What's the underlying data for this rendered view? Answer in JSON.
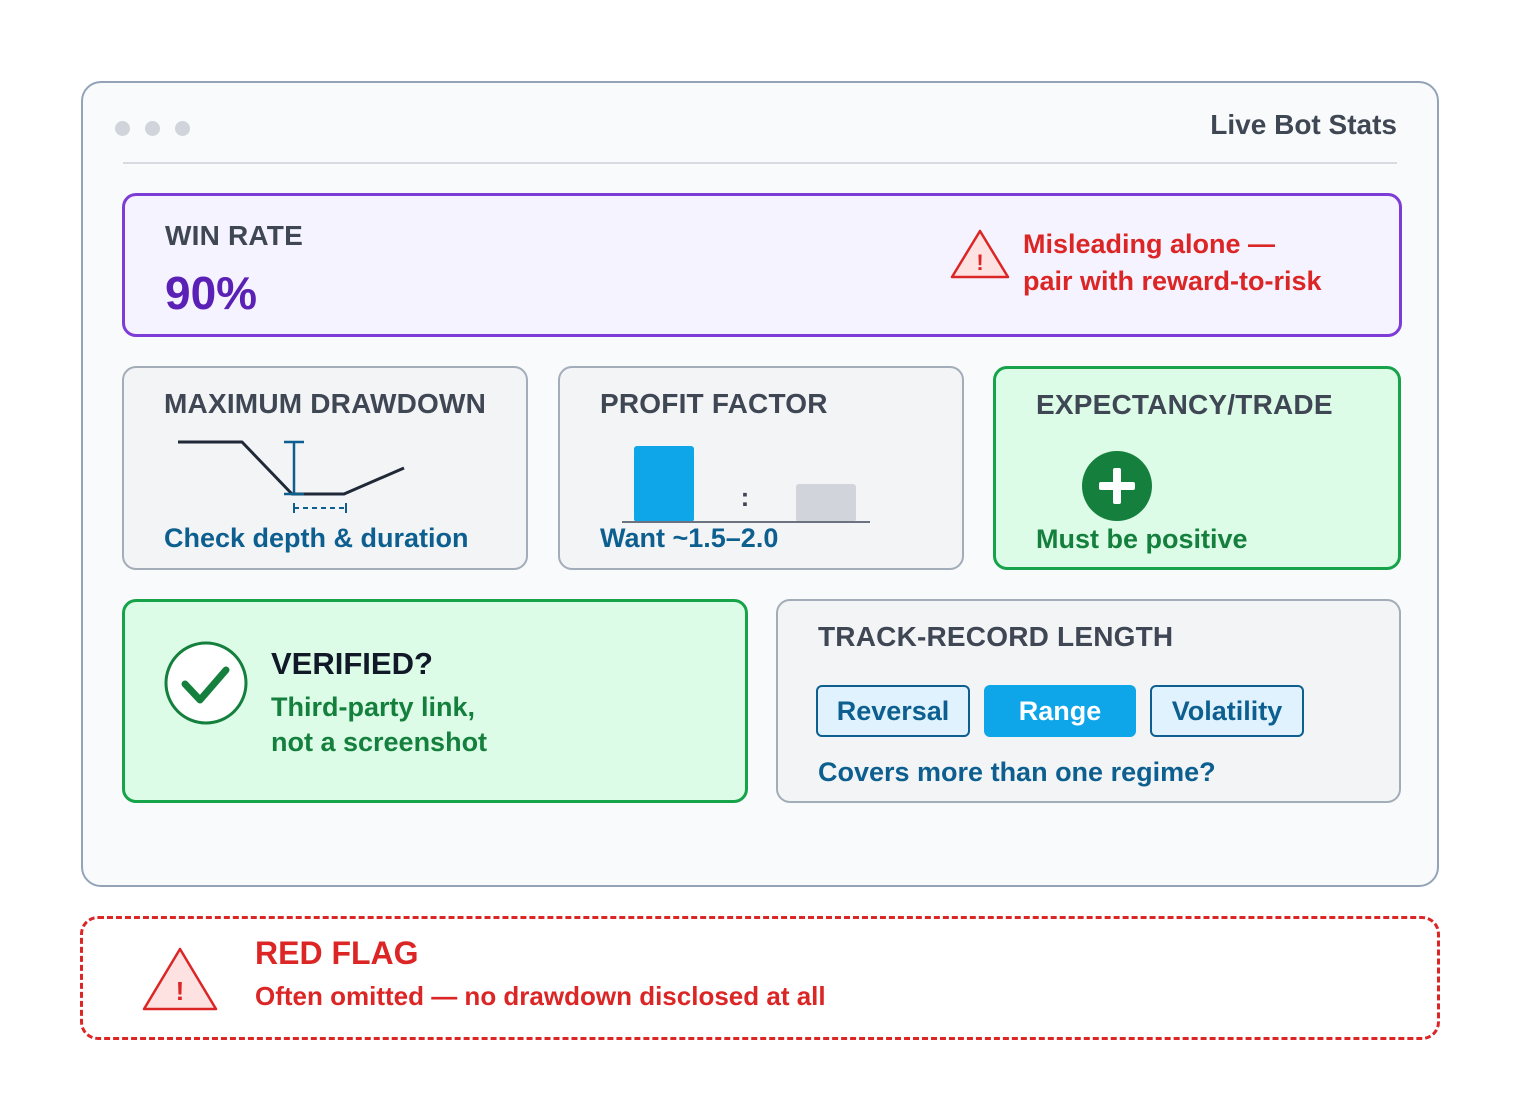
{
  "window": {
    "title": "Live Bot Stats"
  },
  "win_rate": {
    "label": "WIN RATE",
    "value": "90%",
    "warning_line1": "Misleading alone —",
    "warning_line2": "pair with reward-to-risk",
    "warning_icon": "warning-triangle-icon"
  },
  "max_drawdown": {
    "label": "MAXIMUM DRAWDOWN",
    "note": "Check depth & duration",
    "icon": "drawdown-curve-icon"
  },
  "profit_factor": {
    "label": "PROFIT FACTOR",
    "separator": ":",
    "note": "Want ~1.5–2.0",
    "icon": "ratio-bars-icon"
  },
  "expectancy": {
    "label": "EXPECTANCY/TRADE",
    "note": "Must be positive",
    "icon": "plus-circle-icon"
  },
  "verified": {
    "title": "VERIFIED?",
    "line1": "Third-party link,",
    "line2": "not a screenshot",
    "icon": "checkmark-circle-icon"
  },
  "track_record": {
    "label": "TRACK-RECORD LENGTH",
    "chips": [
      {
        "label": "Reversal",
        "active": false
      },
      {
        "label": "Range",
        "active": true
      },
      {
        "label": "Volatility",
        "active": false
      }
    ],
    "question": "Covers more than one regime?"
  },
  "red_flag": {
    "title": "RED FLAG",
    "text": "Often omitted — no drawdown disclosed at all",
    "icon": "warning-triangle-icon"
  },
  "colors": {
    "purple": "#7e3cd6",
    "red": "#dc2626",
    "blue_text": "#0c5f8f",
    "green": "#16a34a",
    "sky": "#0ea5e9"
  }
}
